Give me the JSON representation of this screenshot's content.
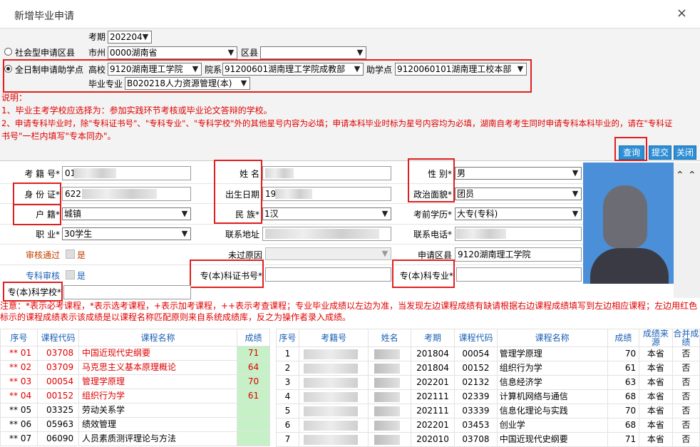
{
  "dialog": {
    "title": "新增毕业申请",
    "close": "×"
  },
  "filters": {
    "exam_period_label": "考期",
    "exam_period": "202204",
    "social_label": "社会型申请区县",
    "city_label": "市州",
    "city": "0000湖南省",
    "district_label": "区县",
    "district": "",
    "fulltime_label": "全日制申请助学点",
    "univ_label": "高校",
    "univ": "9120湖南理工学院",
    "college_label": "院系",
    "college": "91200601湖南理工学院成教部",
    "assist_label": "助学点",
    "assist": "9120060101湖南理工校本部",
    "major_label": "毕业专业",
    "major": "B020218人力资源管理(本)"
  },
  "notes": [
    "说明：",
    "1、毕业主考学校应选择为：参加实践环节考核或毕业论文答辩的学校。",
    "2、申请专科毕业时，除\"专科证书号\"、\"专科专业\"、\"专科学校\"外的其他星号内容为必填；申请本科毕业时标为星号内容均为必填，湖南自考考生同时申请专科本科毕业的，请在\"专科证",
    "书号\"一栏内填写\"专本同办\"。"
  ],
  "buttons": {
    "query": "查询",
    "submit": "提交",
    "close": "关闭"
  },
  "form": {
    "exam_no_label": "考 籍 号*",
    "exam_no": "01",
    "name_label": "姓   名",
    "gender_label": "性   别*",
    "gender": "男",
    "id_label": "身 份 证*",
    "id_value": "622",
    "birth_label": "出生日期",
    "birth": "19",
    "politics_label": "政治面貌*",
    "politics": "团员",
    "hukou_label": "户   籍*",
    "hukou": "城镇",
    "ethnic_label": "民   族*",
    "ethnic": "1汉",
    "edu_label": "考前学历*",
    "edu": "大专(专科)",
    "job_label": "职   业*",
    "job": "30学生",
    "addr_label": "联系地址",
    "phone_label": "联系电话*",
    "audit_label": "审核通过",
    "audit_val": "是",
    "fail_label": "未过原因",
    "region_label": "申请区县",
    "region": "9120湖南理工学院",
    "zk_audit_label": "专科审核",
    "zk_audit_val": "是",
    "zk_cert_label": "专(本)科证书号*",
    "zk_major_label": "专(本)科专业*",
    "zk_school_label": "专(本)科学校*"
  },
  "warning": "注意：*表示必考课程，*表示选考课程，+表示加考课程，++表示考查课程；专业毕业成绩以左边为准，当发现左边课程成绩有缺请根据右边课程成绩填写到左边相应课程；左边用红色标示的课程成绩表示该成绩是以课程名称匹配原则来自系统成绩库，反之为操作者录入成绩。",
  "left_table": {
    "headers": [
      "序号",
      "课程代码",
      "课程名称",
      "成绩"
    ],
    "rows": [
      {
        "no": "** 01",
        "code": "03708",
        "name": "中国近现代史纲要",
        "score": "71",
        "red": true
      },
      {
        "no": "** 02",
        "code": "03709",
        "name": "马克思主义基本原理概论",
        "score": "64",
        "red": true
      },
      {
        "no": "** 03",
        "code": "00054",
        "name": "管理学原理",
        "score": "70",
        "red": true
      },
      {
        "no": "** 04",
        "code": "00152",
        "name": "组织行为学",
        "score": "61",
        "red": true
      },
      {
        "no": "** 05",
        "code": "03325",
        "name": "劳动关系学",
        "score": "",
        "red": false
      },
      {
        "no": "** 06",
        "code": "05963",
        "name": "绩效管理",
        "score": "",
        "red": false
      },
      {
        "no": "** 07",
        "code": "06090",
        "name": "人员素质测评理论与方法",
        "score": "",
        "red": false
      }
    ]
  },
  "right_table": {
    "headers": [
      "序号",
      "考籍号",
      "姓名",
      "考期",
      "课程代码",
      "课程名称",
      "成绩",
      "成绩来源",
      "合并成绩"
    ],
    "rows": [
      {
        "no": "1",
        "period": "201804",
        "code": "00054",
        "name": "管理学原理",
        "score": "70",
        "src": "本省",
        "merge": "否"
      },
      {
        "no": "2",
        "period": "201804",
        "code": "00152",
        "name": "组织行为学",
        "score": "61",
        "src": "本省",
        "merge": "否"
      },
      {
        "no": "3",
        "period": "202201",
        "code": "02132",
        "name": "信息经济学",
        "score": "63",
        "src": "本省",
        "merge": "否"
      },
      {
        "no": "4",
        "period": "202111",
        "code": "02339",
        "name": "计算机网络与通信",
        "score": "68",
        "src": "本省",
        "merge": "否"
      },
      {
        "no": "5",
        "period": "202111",
        "code": "03339",
        "name": "信息化理论与实践",
        "score": "70",
        "src": "本省",
        "merge": "否"
      },
      {
        "no": "6",
        "period": "202201",
        "code": "03453",
        "name": "创业学",
        "score": "68",
        "src": "本省",
        "merge": "否"
      },
      {
        "no": "7",
        "period": "202010",
        "code": "03708",
        "name": "中国近现代史纲要",
        "score": "71",
        "src": "本省",
        "merge": "否"
      }
    ]
  }
}
